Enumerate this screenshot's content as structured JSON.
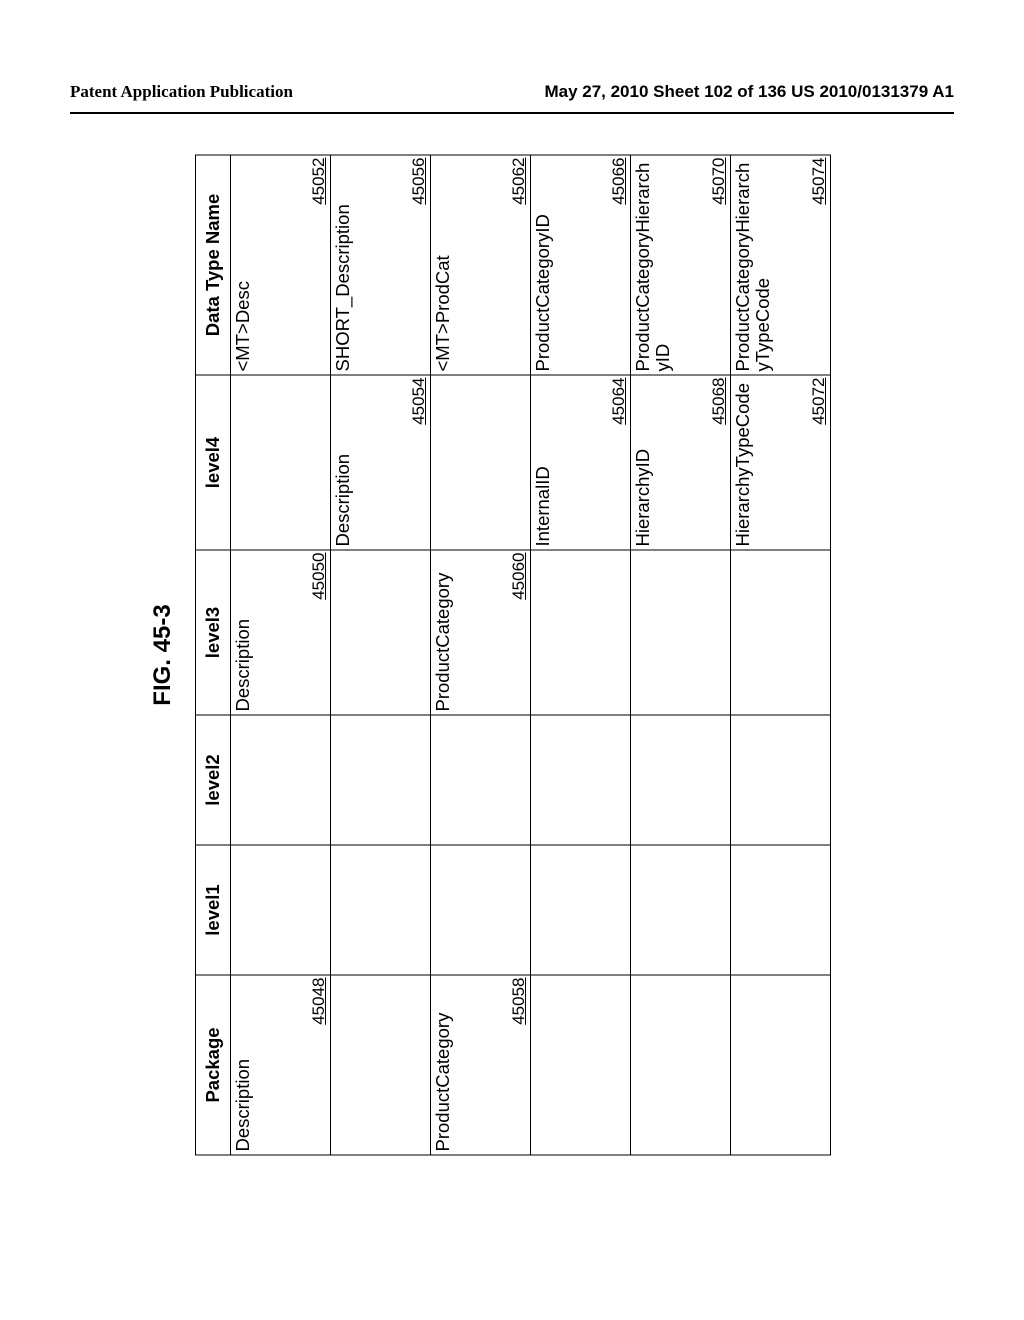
{
  "header": {
    "left": "Patent Application Publication",
    "right": "May 27, 2010  Sheet 102 of 136   US 2010/0131379 A1"
  },
  "figure_title": "FIG. 45-3",
  "columns": {
    "c0": "Package",
    "c1": "level1",
    "c2": "level2",
    "c3": "level3",
    "c4": "level4",
    "c5": "Data Type Name"
  },
  "rows": [
    {
      "package": "Description",
      "package_ref": "45048",
      "level3": "Description",
      "level3_ref": "45050",
      "dtn": "<MT>Desc",
      "dtn_ref": "45052"
    },
    {
      "level4": "Description",
      "level4_ref": "45054",
      "dtn": "SHORT_Description",
      "dtn_ref": "45056"
    },
    {
      "package": "ProductCategory",
      "package_ref": "45058",
      "level3": "ProductCategory",
      "level3_ref": "45060",
      "dtn": "<MT>ProdCat",
      "dtn_ref": "45062"
    },
    {
      "level4": "InternalID",
      "level4_ref": "45064",
      "dtn": "ProductCategoryID",
      "dtn_ref": "45066"
    },
    {
      "level4": "HierarchyID",
      "level4_ref": "45068",
      "dtn": "ProductCategoryHierarchyID",
      "dtn_ref": "45070"
    },
    {
      "level4": "HierarchyTypeCode",
      "level4_ref": "45072",
      "dtn": "ProductCategoryHierarchyTypeCode",
      "dtn_ref": "45074"
    }
  ]
}
